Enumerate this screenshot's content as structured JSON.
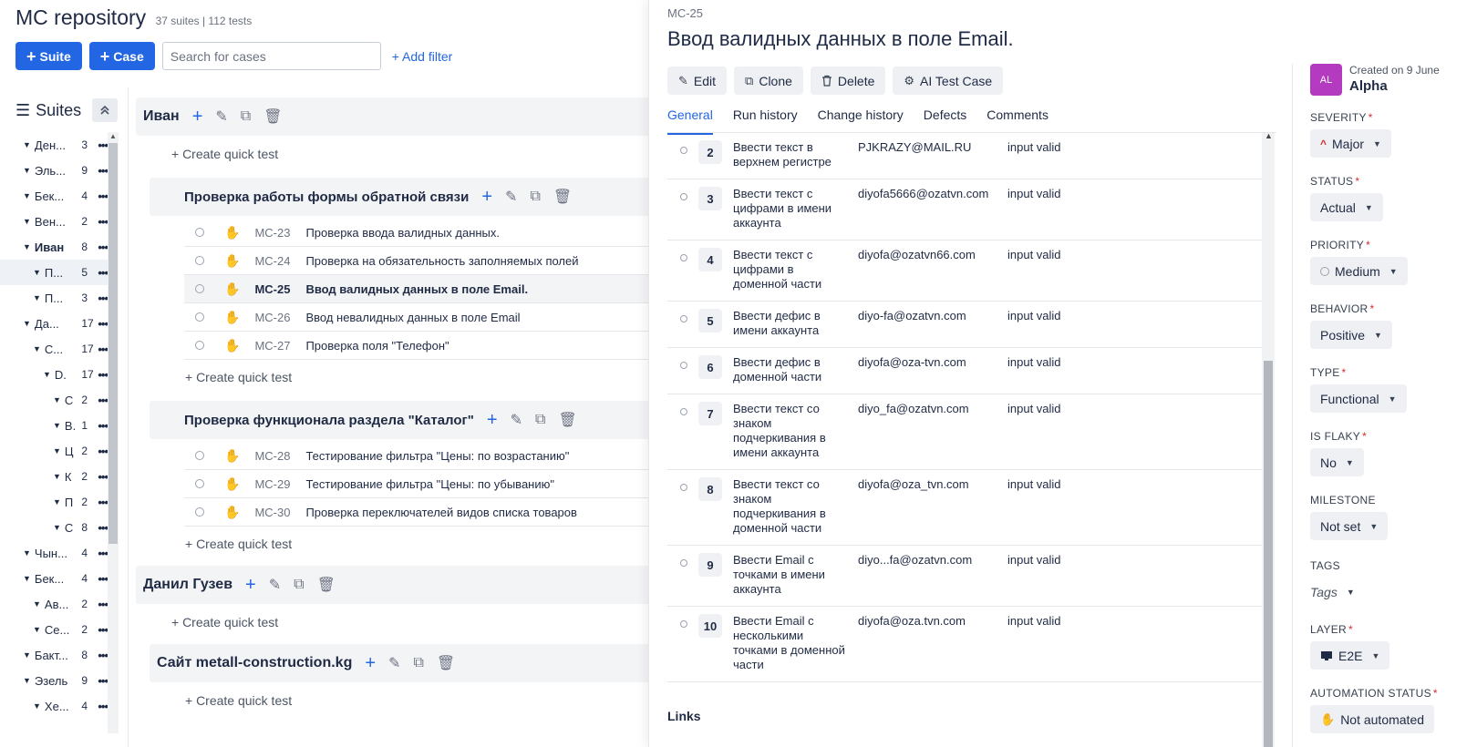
{
  "repo": {
    "title": "MC repository",
    "meta": "37 suites | 112 tests"
  },
  "toolbar": {
    "suite_label": "Suite",
    "case_label": "Case",
    "search_placeholder": "Search for cases",
    "add_filter": "+ Add filter"
  },
  "suites_panel": {
    "title": "Suites"
  },
  "tree": [
    {
      "name": "Ден...",
      "count": "3",
      "indent": 0,
      "bold": false,
      "sel": false
    },
    {
      "name": "Эль...",
      "count": "9",
      "indent": 0,
      "bold": false,
      "sel": false
    },
    {
      "name": "Бек...",
      "count": "4",
      "indent": 0,
      "bold": false,
      "sel": false
    },
    {
      "name": "Вен...",
      "count": "2",
      "indent": 0,
      "bold": false,
      "sel": false
    },
    {
      "name": "Иван",
      "count": "8",
      "indent": 0,
      "bold": true,
      "sel": false
    },
    {
      "name": "П...",
      "count": "5",
      "indent": 1,
      "bold": false,
      "sel": true
    },
    {
      "name": "П...",
      "count": "3",
      "indent": 1,
      "bold": false,
      "sel": false
    },
    {
      "name": "Да...",
      "count": "17",
      "indent": 0,
      "bold": false,
      "sel": false
    },
    {
      "name": "С...",
      "count": "17",
      "indent": 1,
      "bold": false,
      "sel": false
    },
    {
      "name": "D.",
      "count": "17",
      "indent": 2,
      "bold": false,
      "sel": false
    },
    {
      "name": "С",
      "count": "2",
      "indent": 3,
      "bold": false,
      "sel": false
    },
    {
      "name": "B.",
      "count": "1",
      "indent": 3,
      "bold": false,
      "sel": false
    },
    {
      "name": "Ц",
      "count": "2",
      "indent": 3,
      "bold": false,
      "sel": false
    },
    {
      "name": "К",
      "count": "2",
      "indent": 3,
      "bold": false,
      "sel": false
    },
    {
      "name": "П",
      "count": "2",
      "indent": 3,
      "bold": false,
      "sel": false
    },
    {
      "name": "С",
      "count": "8",
      "indent": 3,
      "bold": false,
      "sel": false
    },
    {
      "name": "Чын...",
      "count": "4",
      "indent": 0,
      "bold": false,
      "sel": false
    },
    {
      "name": "Бек...",
      "count": "4",
      "indent": 0,
      "bold": false,
      "sel": false
    },
    {
      "name": "Ав...",
      "count": "2",
      "indent": 1,
      "bold": false,
      "sel": false
    },
    {
      "name": "Се...",
      "count": "2",
      "indent": 1,
      "bold": false,
      "sel": false
    },
    {
      "name": "Бакт...",
      "count": "8",
      "indent": 0,
      "bold": false,
      "sel": false
    },
    {
      "name": "Эзель",
      "count": "9",
      "indent": 0,
      "bold": false,
      "sel": false
    },
    {
      "name": "Хе...",
      "count": "4",
      "indent": 1,
      "bold": false,
      "sel": false
    }
  ],
  "content": {
    "suite_ivan": "Иван",
    "quick_test": "+ Create quick test",
    "suite_feedback": "Проверка работы формы обратной связи",
    "suite_catalog": "Проверка функционала раздела \"Каталог\"",
    "suite_danil": "Данил Гузев",
    "suite_metall": "Сайт metall-construction.kg",
    "feedback_cases": [
      {
        "id": "MC-23",
        "title": "Проверка ввода валидных данных."
      },
      {
        "id": "MC-24",
        "title": "Проверка на обязательность заполняемых полей"
      },
      {
        "id": "MC-25",
        "title": "Ввод валидных данных в поле Email."
      },
      {
        "id": "MC-26",
        "title": "Ввод невалидных данных в поле Email"
      },
      {
        "id": "MC-27",
        "title": "Проверка поля \"Телефон\""
      }
    ],
    "catalog_cases": [
      {
        "id": "MC-28",
        "title": "Тестирование фильтра \"Цены: по возрастанию\""
      },
      {
        "id": "MC-29",
        "title": "Тестирование фильтра \"Цены: по убыванию\""
      },
      {
        "id": "MC-30",
        "title": "Проверка переключателей видов списка товаров"
      }
    ]
  },
  "detail": {
    "key": "MC-25",
    "title": "Ввод валидных данных в поле Email.",
    "actions": {
      "edit": "Edit",
      "clone": "Clone",
      "delete": "Delete",
      "ai": "AI Test Case"
    },
    "tabs": {
      "general": "General",
      "run_history": "Run history",
      "change_history": "Change history",
      "defects": "Defects",
      "comments": "Comments"
    },
    "steps": [
      {
        "num": "2",
        "action": "Ввести текст в верхнем регистре",
        "data": "PJKRAZY@MAIL.RU",
        "expected": "input valid"
      },
      {
        "num": "3",
        "action": "Ввести текст с цифрами в имени аккаунта",
        "data": "diyofa5666@ozatvn.com",
        "expected": "input valid"
      },
      {
        "num": "4",
        "action": "Ввести текст с цифрами в доменной части",
        "data": "diyofa@ozatvn66.com",
        "expected": "input valid"
      },
      {
        "num": "5",
        "action": "Ввести дефис в имени аккаунта",
        "data": "diyo-fa@ozatvn.com",
        "expected": "input valid"
      },
      {
        "num": "6",
        "action": "Ввести дефис в доменной части",
        "data": "diyofa@oza-tvn.com",
        "expected": "input valid"
      },
      {
        "num": "7",
        "action": "Ввести текст со знаком подчеркивания в имени аккаунта",
        "data": "diyo_fa@ozatvn.com",
        "expected": "input valid"
      },
      {
        "num": "8",
        "action": "Ввести текст со знаком подчеркивания в доменной части",
        "data": "diyofa@oza_tvn.com",
        "expected": "input valid"
      },
      {
        "num": "9",
        "action": "Ввести Email с точками в имени аккаунта",
        "data": "diyo...fa@ozatvn.com",
        "expected": "input valid"
      },
      {
        "num": "10",
        "action": "Ввести Email с несколькими точками в доменной части",
        "data": "diyofa@oza.tvn.com",
        "expected": "input valid"
      }
    ],
    "links_label": "Links"
  },
  "props": {
    "avatar_initials": "AL",
    "created": "Created on 9 June",
    "author": "Alpha",
    "severity": {
      "label": "SEVERITY",
      "value": "Major"
    },
    "status": {
      "label": "STATUS",
      "value": "Actual"
    },
    "priority": {
      "label": "PRIORITY",
      "value": "Medium"
    },
    "behavior": {
      "label": "BEHAVIOR",
      "value": "Positive"
    },
    "type": {
      "label": "TYPE",
      "value": "Functional"
    },
    "is_flaky": {
      "label": "IS FLAKY",
      "value": "No"
    },
    "milestone": {
      "label": "MILESTONE",
      "value": "Not set"
    },
    "tags": {
      "label": "TAGS",
      "value": "Tags"
    },
    "layer": {
      "label": "LAYER",
      "value": "E2E"
    },
    "automation": {
      "label": "AUTOMATION STATUS",
      "value": "Not automated"
    }
  },
  "colors": {
    "accent": "#2266e3",
    "required": "#d12d2d",
    "avatar": "#b43ac0"
  }
}
